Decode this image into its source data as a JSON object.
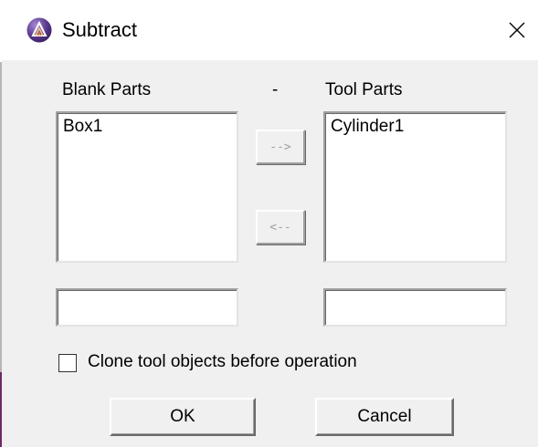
{
  "window": {
    "title": "Subtract",
    "icon": "app-logo-icon",
    "close_icon": "close-icon"
  },
  "blank_parts": {
    "label": "Blank Parts",
    "items": [
      "Box1"
    ],
    "field_value": ""
  },
  "separator": "-",
  "tool_parts": {
    "label": "Tool Parts",
    "items": [
      "Cylinder1"
    ],
    "field_value": ""
  },
  "move_right_label": "-->",
  "move_left_label": "<--",
  "clone_option": {
    "label": "Clone tool objects before operation",
    "checked": false
  },
  "buttons": {
    "ok": "OK",
    "cancel": "Cancel"
  }
}
